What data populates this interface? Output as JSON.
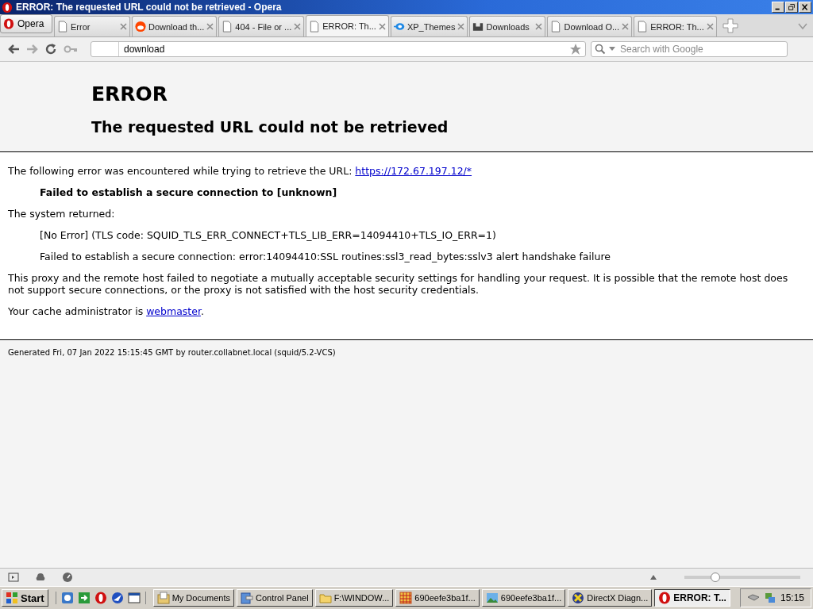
{
  "window": {
    "title": "ERROR: The requested URL could not be retrieved - Opera"
  },
  "menu_button": {
    "label": "Opera"
  },
  "tabs": [
    {
      "label": "Error",
      "selected": false
    },
    {
      "label": "Download th...",
      "selected": false
    },
    {
      "label": "404 - File or ...",
      "selected": false
    },
    {
      "label": "ERROR: Th...",
      "selected": true
    },
    {
      "label": "XP_Themes",
      "selected": false
    },
    {
      "label": "Downloads",
      "selected": false
    },
    {
      "label": "Download O...",
      "selected": false
    },
    {
      "label": "ERROR: Th...",
      "selected": false
    }
  ],
  "address_bar": {
    "value": "download"
  },
  "search": {
    "placeholder": "Search with Google"
  },
  "page": {
    "heading": "ERROR",
    "subheading": "The requested URL could not be retrieved",
    "blocks": [
      {
        "kind": "text",
        "text": "The following error was encountered while trying to retrieve the URL: ",
        "link": "https://172.67.197.12/*"
      },
      {
        "kind": "indent-bold",
        "text": "Failed to establish a secure connection to [unknown]"
      },
      {
        "kind": "text",
        "text": "The system returned:"
      },
      {
        "kind": "indent",
        "text": "[No Error] (TLS code: SQUID_TLS_ERR_CONNECT+TLS_LIB_ERR=14094410+TLS_IO_ERR=1)"
      },
      {
        "kind": "indent",
        "text": "Failed to establish a secure connection: error:14094410:SSL routines:ssl3_read_bytes:sslv3 alert handshake failure"
      },
      {
        "kind": "text",
        "text": "This proxy and the remote host failed to negotiate a mutually acceptable security settings for handling your request. It is possible that the remote host does not support secure connections, or the proxy is not satisfied with the host security credentials."
      },
      {
        "kind": "text",
        "text": "Your cache administrator is ",
        "link": "webmaster",
        "after": "."
      }
    ],
    "footer": "Generated Fri, 07 Jan 2022 15:15:45 GMT by router.collabnet.local (squid/5.2-VCS)"
  },
  "status_bar": {
    "zoom": {
      "level": 0.27
    }
  },
  "taskbar": {
    "start": "Start",
    "tasks": [
      {
        "label": "My Documents",
        "selected": false
      },
      {
        "label": "Control Panel",
        "selected": false
      },
      {
        "label": "F:\\WINDOW...",
        "selected": false
      },
      {
        "label": "690eefe3ba1f...",
        "selected": false
      },
      {
        "label": "690eefe3ba1f...",
        "selected": false
      },
      {
        "label": "DirectX Diagn...",
        "selected": false
      },
      {
        "label": "ERROR: T...",
        "selected": true
      }
    ],
    "clock": "15:15"
  }
}
